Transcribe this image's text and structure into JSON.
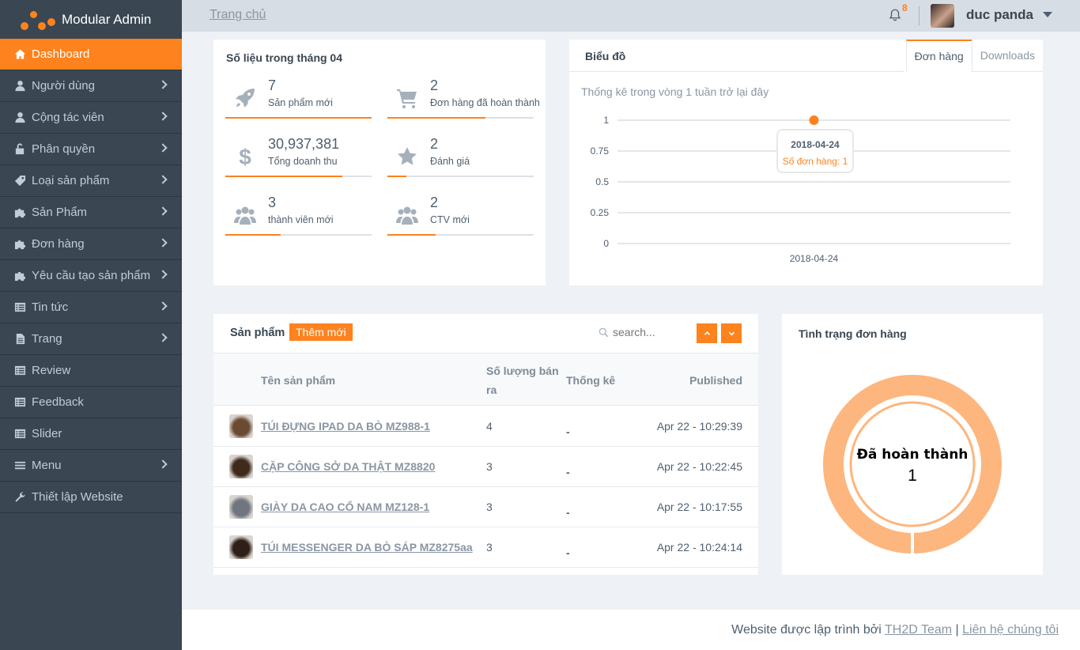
{
  "brand": {
    "name": "Modular Admin"
  },
  "sidebar": {
    "items": [
      {
        "label": "Dashboard",
        "icon": "home-icon",
        "active": true,
        "chevron": false
      },
      {
        "label": "Người dùng",
        "icon": "user-icon",
        "chevron": true
      },
      {
        "label": "Cộng tác viên",
        "icon": "user-icon",
        "chevron": true
      },
      {
        "label": "Phân quyền",
        "icon": "unlock-icon",
        "chevron": true
      },
      {
        "label": "Loại sản phẩm",
        "icon": "tag-icon",
        "chevron": true
      },
      {
        "label": "Sản Phẩm",
        "icon": "puzzle-icon",
        "chevron": true
      },
      {
        "label": "Đơn hàng",
        "icon": "puzzle-icon",
        "chevron": true
      },
      {
        "label": "Yêu cầu tạo sản phẩm",
        "icon": "puzzle-icon",
        "chevron": true
      },
      {
        "label": "Tin tức",
        "icon": "list-icon",
        "chevron": true
      },
      {
        "label": "Trang",
        "icon": "file-icon",
        "chevron": true
      },
      {
        "label": "Review",
        "icon": "list-icon",
        "chevron": false
      },
      {
        "label": "Feedback",
        "icon": "list-icon",
        "chevron": false
      },
      {
        "label": "Slider",
        "icon": "list-icon",
        "chevron": false
      },
      {
        "label": "Menu",
        "icon": "bars-icon",
        "chevron": true
      },
      {
        "label": "Thiết lập Website",
        "icon": "wrench-icon",
        "chevron": false
      }
    ]
  },
  "header": {
    "breadcrumb": "Trang chủ",
    "notification_count": "8",
    "username": "duc panda"
  },
  "stats": {
    "title": "Số liệu trong tháng 04",
    "items": [
      {
        "value": "7",
        "label": "Sản phẩm mới",
        "icon": "rocket-icon",
        "progress": 1.0
      },
      {
        "value": "2",
        "label": "Đơn hàng đã hoàn thành",
        "icon": "cart-icon",
        "progress": 0.67
      },
      {
        "value": "30,937,381",
        "label": "Tổng doanh thu",
        "icon": "dollar-icon",
        "progress": 0.8
      },
      {
        "value": "2",
        "label": "Đánh giá",
        "icon": "star-icon",
        "progress": 0.13
      },
      {
        "value": "3",
        "label": "thành viên mới",
        "icon": "users-icon",
        "progress": 0.38
      },
      {
        "value": "2",
        "label": "CTV mới",
        "icon": "users-icon",
        "progress": 0.33
      }
    ]
  },
  "chart_card": {
    "title": "Biểu đồ",
    "tabs": [
      "Đơn hàng",
      "Downloads"
    ],
    "subtitle": "Thống kê trong vòng 1 tuần trở lại đây",
    "tooltip_date": "2018-04-24",
    "tooltip_label": "Số đơn hàng: 1"
  },
  "chart_data": {
    "type": "line",
    "x": [
      "2018-04-24"
    ],
    "series": [
      {
        "name": "Số đơn hàng",
        "values": [
          1
        ]
      }
    ],
    "ylim": [
      0,
      1
    ],
    "yticks": [
      "1",
      "0.75",
      "0.5",
      "0.25",
      "0"
    ],
    "grid": true,
    "color": "#fe821d"
  },
  "products": {
    "title": "Sản phẩm",
    "add_label": "Thêm mới",
    "search_placeholder": "search...",
    "columns": {
      "name": "Tên sản phẩm",
      "qty_line1": "Số lượng bán",
      "qty_line2": "ra",
      "stats": "Thống kê",
      "published": "Published"
    },
    "rows": [
      {
        "name": "TÚI ĐỰNG IPAD DA BÒ MZ988-1",
        "qty": "4",
        "stat": "-",
        "published": "Apr 22 - 10:29:39",
        "thumb": "#6b4a32"
      },
      {
        "name": "CẶP CÔNG SỞ DA THẬT MZ8820",
        "qty": "3",
        "stat": "-",
        "published": "Apr 22 - 10:22:45",
        "thumb": "#3f2a1c"
      },
      {
        "name": "GIÀY DA CAO CỔ NAM MZ128-1",
        "qty": "3",
        "stat": "-",
        "published": "Apr 22 - 10:17:55",
        "thumb": "#6f7680"
      },
      {
        "name": "TÚI MESSENGER DA BÒ SÁP MZ8275aa",
        "qty": "3",
        "stat": "-",
        "published": "Apr 22 - 10:24:14",
        "thumb": "#2e1f18"
      }
    ]
  },
  "order_status": {
    "title": "Tình trạng đơn hàng",
    "center_label": "Đã hoàn thành",
    "center_value": "1",
    "color": "#fdb67e"
  },
  "footer": {
    "text": "Website được lập trình bởi",
    "team": "TH2D Team",
    "separator": "|",
    "contact": "Liên hệ chúng tôi"
  }
}
